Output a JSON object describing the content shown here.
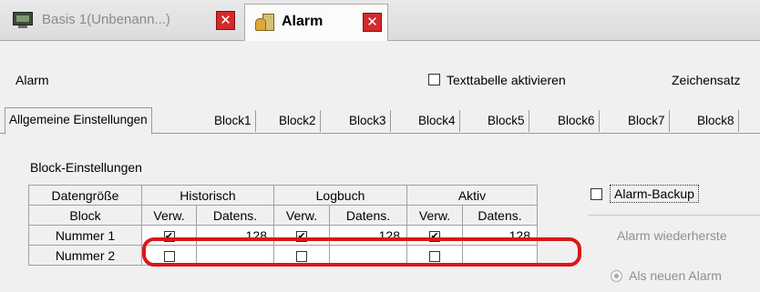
{
  "doc_tabs": {
    "inactive": {
      "label": "Basis 1(Unbenann...)",
      "close": "✕"
    },
    "active": {
      "label": "Alarm",
      "close": "✕"
    }
  },
  "header": {
    "title": "Alarm",
    "texttable_checkbox": {
      "label": "Texttabelle aktivieren",
      "checked": false
    },
    "charset_label": "Zeichensatz"
  },
  "settings_tabs": [
    "Allgemeine Einstellungen",
    "Block1",
    "Block2",
    "Block3",
    "Block4",
    "Block5",
    "Block6",
    "Block7",
    "Block8"
  ],
  "block_settings": {
    "label": "Block-Einstellungen",
    "header_row1": {
      "size": "Datengröße",
      "historic": "Historisch",
      "log": "Logbuch",
      "active": "Aktiv"
    },
    "header_row2": {
      "block": "Block",
      "verw": "Verw.",
      "datens": "Datens."
    },
    "rows": [
      {
        "name": "Nummer 1",
        "hist_used": "✔",
        "hist_size": "128",
        "log_used": "✔",
        "log_size": "128",
        "act_used": "✔",
        "act_size": "128"
      },
      {
        "name": "Nummer 2",
        "hist_used": "",
        "hist_size": "",
        "log_used": "",
        "log_size": "",
        "act_used": "",
        "act_size": ""
      }
    ]
  },
  "right_panel": {
    "backup_label": "Alarm-Backup",
    "restore_label": "Alarm wiederherste",
    "new_alarm_label": "Als neuen Alarm"
  },
  "colors": {
    "highlight": "#d81818",
    "close_button": "#d32a2a"
  }
}
